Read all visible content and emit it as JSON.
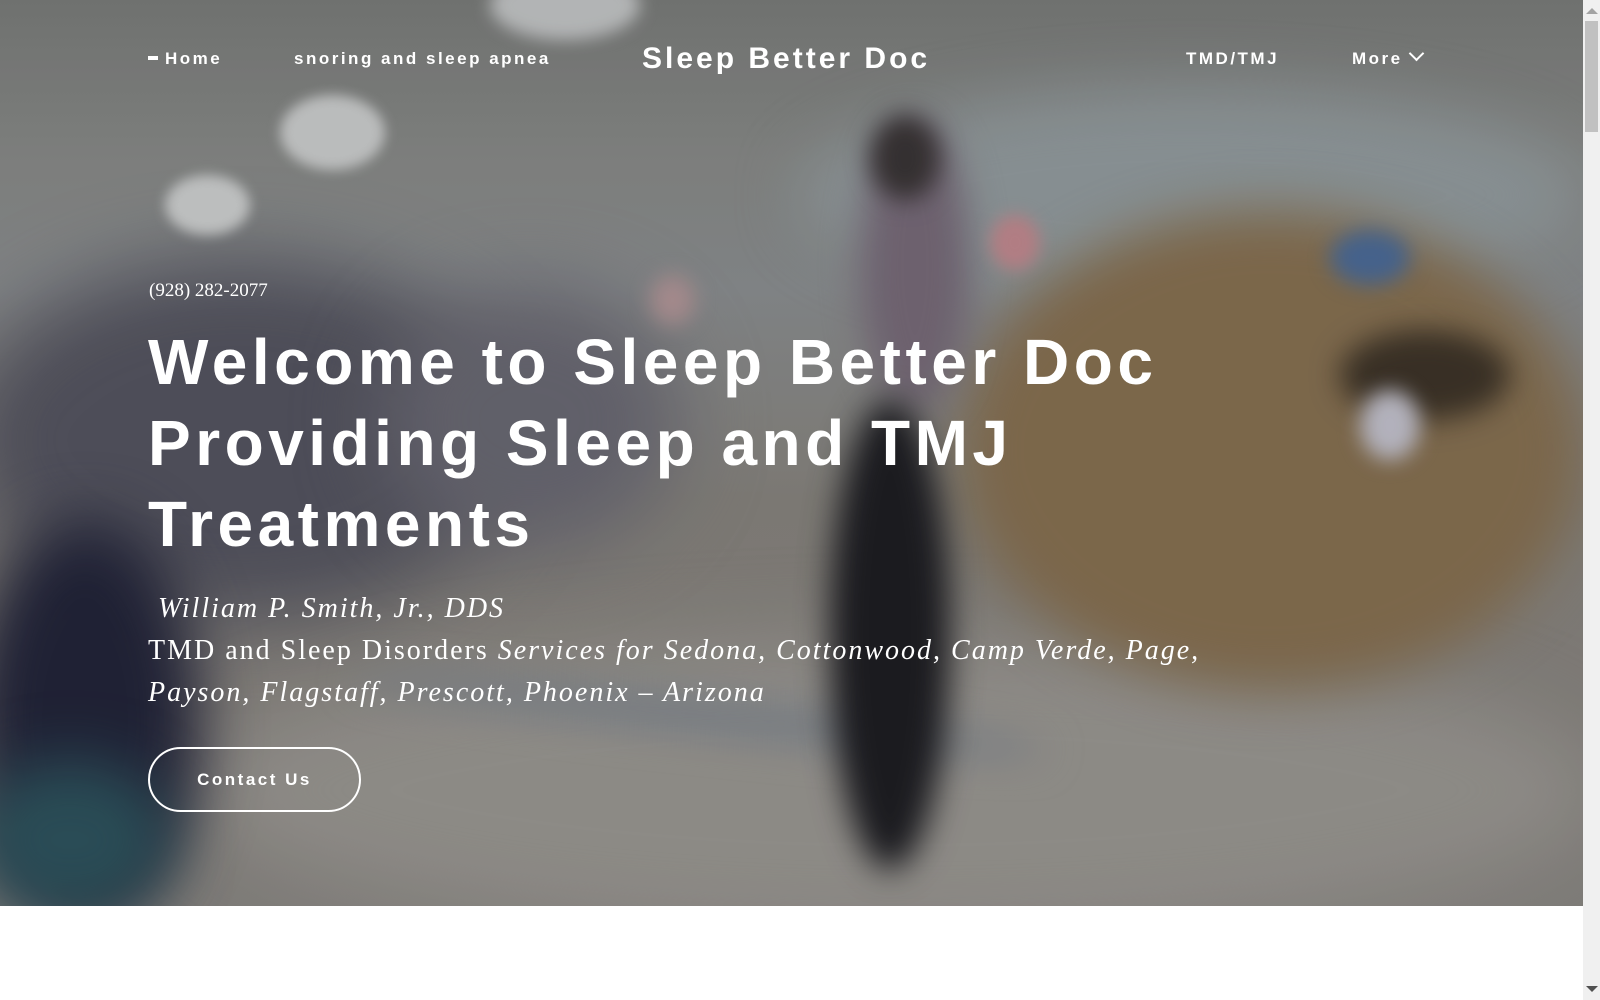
{
  "nav": {
    "home_label": "Home",
    "snoring_label": "snoring and sleep apnea",
    "brand": "Sleep Better Doc",
    "tmd_label": "TMD/TMJ",
    "more_label": "More",
    "more_icon": "chevron-down-icon",
    "home_icon": "dash-icon"
  },
  "hero": {
    "phone": "(928) 282-2077",
    "headline": "Welcome to Sleep Better Doc Providing Sleep and TMJ Treatments",
    "doctor_name": "William P. Smith, Jr., DDS",
    "services_prefix": "TMD and Sleep Disorders ",
    "services_locations": "Services for Sedona, Cottonwood, Camp Verde, Page, Payson, Flagstaff, Prescott, Phoenix – Arizona",
    "cta_label": "Contact Us",
    "background_description": "blurred medical clinic waiting room photo"
  },
  "colors": {
    "text": "#ffffff",
    "below_fold_bg": "#ffffff",
    "scrollbar_track": "#f0f0f0",
    "scrollbar_thumb": "#c1c1c1"
  }
}
